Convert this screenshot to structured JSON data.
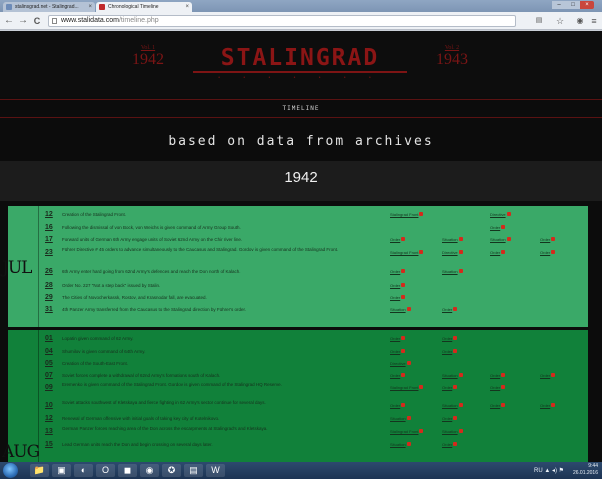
{
  "browser": {
    "tabs": [
      {
        "label": "stalinsgrad.net - Stalingrad...",
        "active": false
      },
      {
        "label": "Chronological Timeline",
        "active": true
      }
    ],
    "close_glyph": "×",
    "url_host": "www.stalidata.com",
    "url_path": "/timeline.php",
    "back_glyph": "←",
    "forward_glyph": "→",
    "reload_glyph": "C",
    "star_glyph": "☆",
    "menu_glyph": "≡",
    "win_min": "–",
    "win_max": "□",
    "win_close": "×",
    "colors": {
      "titlebar": "#8fa6c3",
      "toolbar": "#eef1f5"
    }
  },
  "site": {
    "title": "STALINGRAD",
    "title_dots": "• • • • • • •",
    "vol_left": {
      "label": "Vol. 1",
      "year": "1942"
    },
    "vol_right": {
      "label": "Vol. 2",
      "year": "1943"
    },
    "section_label": "TIMELINE",
    "subtitle": "based on data from archives",
    "year": "1942",
    "colors": {
      "title": "#8b1515",
      "block_july": "#3aa968",
      "block_august": "#11813a",
      "marker": "#d42a1c"
    }
  },
  "blocks": [
    {
      "month": "JUL",
      "rows": [
        {
          "day": "12",
          "event": "Creation of the Stalingrad Front.",
          "refs": [
            "Stalingrad Front",
            "",
            "Directive"
          ]
        },
        {
          "day": "16",
          "event": "Following the dismissal of von Bock, von Weichs is given command of Army Group South.",
          "refs": [
            "",
            "",
            "Order"
          ]
        },
        {
          "day": "17",
          "event": "Forward units of German 6th Army engage units of Soviet 62nd Army on the Chir river line.",
          "refs": [
            "Order",
            "Situation",
            "Situation",
            "Order"
          ]
        },
        {
          "day": "23",
          "event": "Führer Directive # 45 orders to advance simultaneously to the Caucasus and Stalingrad. Gordov is given command of the Stalingrad Front.",
          "refs": [
            "Stalingrad Front",
            "Directive",
            "Order",
            "Order"
          ]
        },
        {
          "day": "26",
          "event": "6th Army enter hard going from 62nd Army's defences and reach the Don north of Kalach.",
          "refs": [
            "Order",
            "Situation"
          ]
        },
        {
          "day": "28",
          "event": "Order No. 227 \"Not a step back\" issued by Stalin.",
          "refs": [
            "Order"
          ]
        },
        {
          "day": "29",
          "event": "The Cities of Novocherkassk, Rostov, and Krasnodar fall, are evacuated.",
          "refs": [
            "Order"
          ]
        },
        {
          "day": "31",
          "event": "4th Panzer Army transferred from the Caucasus to the Stalingrad direction by Führer's order.",
          "refs": [
            "Situation",
            "Order"
          ]
        }
      ]
    },
    {
      "month": "AUG",
      "rows": [
        {
          "day": "01",
          "event": "Lopatin given command of 62 Army.",
          "refs": [
            "Order",
            "Order"
          ]
        },
        {
          "day": "04",
          "event": "Shumilov is given command of 64th Army.",
          "refs": [
            "Order",
            "Order"
          ]
        },
        {
          "day": "05",
          "event": "Creation of the South-East Front.",
          "refs": [
            "Directive"
          ]
        },
        {
          "day": "07",
          "event": "Soviet forces complete a withdrawal of 62nd Army's formations south of Kalach.",
          "refs": [
            "Order",
            "Situation",
            "Order",
            "Order"
          ]
        },
        {
          "day": "09",
          "event": "Eremenko is given command of the Stalingrad Front. Gordov is given command of the Stalingrad HQ Reserve.",
          "refs": [
            "Stalingrad Front",
            "Order",
            "Order"
          ]
        },
        {
          "day": "10",
          "event": "Soviet attacks southwest of Kletskaya and fierce fighting in 62 Army's sector continue for several days.",
          "refs": [
            "Order",
            "Situation",
            "Order",
            "Order"
          ]
        },
        {
          "day": "12",
          "event": "Renewal of German offensive with initial goals of taking key city of Kotelnikovo.",
          "refs": [
            "Situation",
            "Order"
          ]
        },
        {
          "day": "13",
          "event": "German Panzer forces reaching area of the Don across the escarpments at Stalingrad's and Kletskaya.",
          "refs": [
            "Stalingrad Front",
            "Situation"
          ]
        },
        {
          "day": "15",
          "event": "Lead German units reach the Don and begin crossing on several days later.",
          "refs": [
            "Situation",
            "Order"
          ]
        }
      ]
    }
  ],
  "taskbar": {
    "apps": [
      "📁",
      "▣",
      "◐",
      "O",
      "◼",
      "◉",
      "✪",
      "▤",
      "W"
    ],
    "time": "9:44",
    "date": "26.01.2016",
    "tray_text": "RU ▲ ◂) ⚑"
  }
}
